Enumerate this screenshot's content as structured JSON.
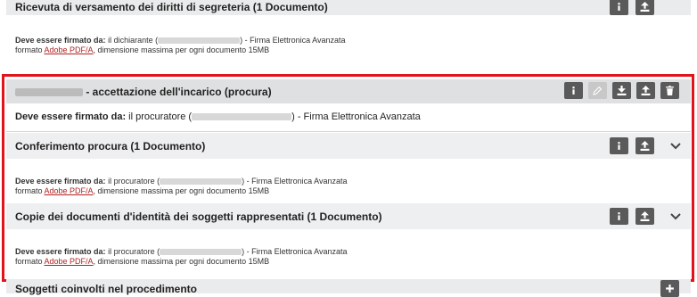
{
  "top_section": {
    "title": "Ricevuta di versamento dei diritti di segreteria (1 Documento)",
    "sign_label": "Deve essere firmato da:",
    "sign_who": " il dichiarante (",
    "sign_rest": ") - Firma Elettronica Avanzata",
    "format_prefix": "formato ",
    "format_link": "Adobe PDF/A",
    "format_suffix": ", dimensione massima per ogni documento 15MB"
  },
  "highlight_group": {
    "title": " - accettazione dell'incarico (procura)",
    "sign_label": "Deve essere firmato da:",
    "sign_who": " il procuratore (",
    "sign_rest": ") - Firma Elettronica Avanzata"
  },
  "sections": [
    {
      "title": "Conferimento procura (1 Documento)",
      "sign_label": "Deve essere firmato da:",
      "sign_who": " il procuratore (",
      "sign_rest": ") - Firma Elettronica Avanzata",
      "format_prefix": "formato ",
      "format_link": "Adobe PDF/A",
      "format_suffix": ", dimensione massima per ogni documento 15MB"
    },
    {
      "title": "Copie dei documenti d'identità dei soggetti rappresentati (1 Documento)",
      "sign_label": "Deve essere firmato da:",
      "sign_who": " il procuratore (",
      "sign_rest": ") - Firma Elettronica Avanzata",
      "format_prefix": "formato ",
      "format_link": "Adobe PDF/A",
      "format_suffix": ", dimensione massima per ogni documento 15MB"
    }
  ],
  "bottom_section": {
    "title": "Soggetti coinvolti nel procedimento"
  },
  "colors": {
    "highlight_border": "#e3131b",
    "button_bg": "#5a5a5a",
    "button_disabled_bg": "#c8c8c8",
    "link": "#b22222",
    "header_bg": "#eaebec"
  },
  "icons": {
    "info": "info-icon",
    "upload": "upload-icon",
    "download": "download-icon",
    "edit": "edit-icon",
    "delete": "trash-icon",
    "expand": "chevron-down-icon",
    "add": "plus-icon"
  }
}
